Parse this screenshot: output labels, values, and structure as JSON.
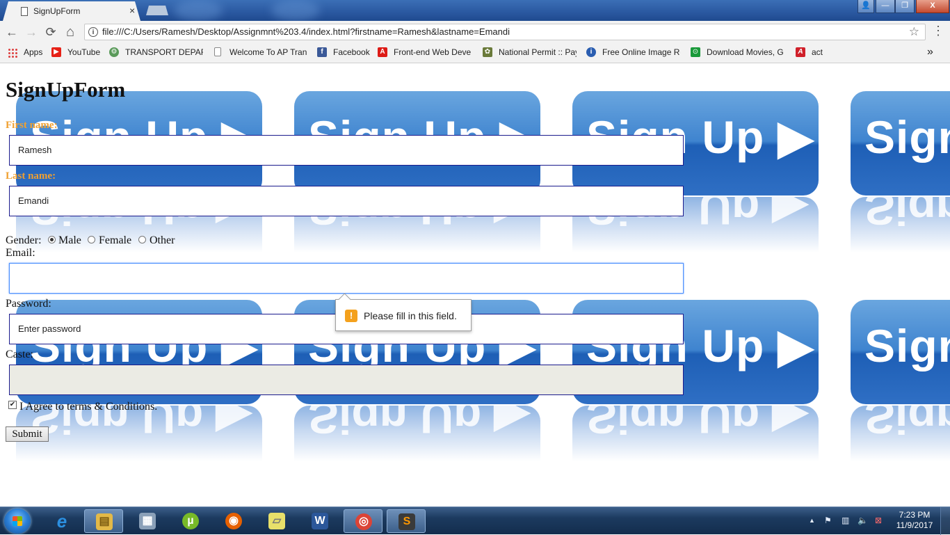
{
  "browser": {
    "tab_title": "SignUpForm",
    "tab_close": "×",
    "url": "file:///C:/Users/Ramesh/Desktop/Assignmnt%203.4/index.html?firstname=Ramesh&lastname=Emandi",
    "icons": {
      "back": "←",
      "forward": "→",
      "reload": "⟳",
      "home": "⌂",
      "info": "i",
      "star": "☆",
      "menu": "⋮",
      "user": "👤",
      "minimize": "—",
      "maximize": "❐",
      "close": "X"
    },
    "bookmarks": [
      {
        "label": "Apps",
        "icon": "apps-grid-icon"
      },
      {
        "label": "YouTube",
        "icon": "youtube-icon",
        "color": "#e62117",
        "glyph": "▶"
      },
      {
        "label": "TRANSPORT DEPART",
        "icon": "transport-seal-icon",
        "color": "#5a9a5a",
        "glyph": "⚙"
      },
      {
        "label": "Welcome To AP Tran",
        "icon": "page-icon",
        "color": "#ffffff",
        "glyph": ""
      },
      {
        "label": "Facebook",
        "icon": "facebook-icon",
        "color": "#3b5998",
        "glyph": "f"
      },
      {
        "label": "Front-end Web Deve",
        "icon": "angular-icon",
        "color": "#dd1b16",
        "glyph": "A"
      },
      {
        "label": "National Permit :: Pay",
        "icon": "national-permit-icon",
        "color": "#6a7a3a",
        "glyph": "✿"
      },
      {
        "label": "Free Online Image Re",
        "icon": "image-resizer-icon",
        "color": "#2a5db0",
        "glyph": "i"
      },
      {
        "label": "Download Movies, G",
        "icon": "download-icon",
        "color": "#1a9a3a",
        "glyph": "⊙"
      },
      {
        "label": "act",
        "icon": "act-icon",
        "color": "#d0202a",
        "glyph": "A"
      }
    ],
    "bookmarks_overflow": "»"
  },
  "page": {
    "background_text": "Sign Up ▶",
    "title": "SignUpForm",
    "first_name_label": "First name:",
    "first_name_value": "Ramesh",
    "last_name_label": "Last name:",
    "last_name_value": "Emandi",
    "gender_label": "Gender:",
    "gender_options": [
      {
        "label": "Male",
        "selected": true
      },
      {
        "label": "Female",
        "selected": false
      },
      {
        "label": "Other",
        "selected": false
      }
    ],
    "email_label": "Email:",
    "email_value": "",
    "password_label": "Password:",
    "password_placeholder": "Enter password",
    "caste_label": "Caste:",
    "caste_value": "",
    "terms_label": "I Agree to terms & Conditions.",
    "terms_checked": true,
    "submit_label": "Submit",
    "validation_message": "Please fill in this field.",
    "validation_icon": "!"
  },
  "taskbar": {
    "apps": [
      {
        "name": "internet-explorer",
        "glyph": "e",
        "color": "#2b8fe0"
      },
      {
        "name": "file-explorer",
        "glyph": "▤",
        "color": "#e3b948"
      },
      {
        "name": "calculator",
        "glyph": "▦",
        "color": "#8aa0b8"
      },
      {
        "name": "utorrent",
        "glyph": "µ",
        "color": "#78b928"
      },
      {
        "name": "firefox",
        "glyph": "◉",
        "color": "#e66000"
      },
      {
        "name": "sticky-notes",
        "glyph": "▱",
        "color": "#e8e06a"
      },
      {
        "name": "word",
        "glyph": "W",
        "color": "#2b579a"
      },
      {
        "name": "chrome",
        "glyph": "◎",
        "color": "#db4437"
      },
      {
        "name": "sublime-text",
        "glyph": "S",
        "color": "#ff9800"
      }
    ],
    "tray": {
      "expand": "▲",
      "flag": "⚑",
      "network": "▥",
      "volume": "🔈",
      "action": "⊠"
    },
    "time": "7:23 PM",
    "date": "11/9/2017"
  }
}
